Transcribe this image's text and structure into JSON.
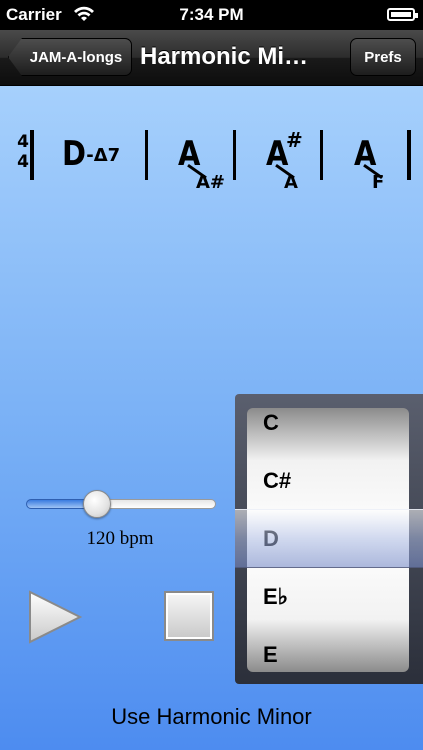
{
  "status_bar": {
    "carrier": "Carrier",
    "time": "7:34 PM"
  },
  "nav": {
    "back_label": "JAM-A-longs",
    "title": "Harmonic Mi…",
    "prefs_label": "Prefs"
  },
  "chart": {
    "time_signature_top": "4",
    "time_signature_bottom": "4",
    "chords": [
      {
        "root": "D",
        "quality": "-Δ7",
        "sharp": "",
        "bass": ""
      },
      {
        "root": "A",
        "quality": "",
        "sharp": "",
        "bass": "A#"
      },
      {
        "root": "A",
        "quality": "",
        "sharp": "#",
        "bass": "A"
      },
      {
        "root": "A",
        "quality": "",
        "sharp": "",
        "bass": "F"
      }
    ]
  },
  "tempo": {
    "bpm_label": "120 bpm",
    "slider_fraction": 0.35
  },
  "picker": {
    "items": [
      "C",
      "C#",
      "D",
      "E♭",
      "E"
    ],
    "selected": "D"
  },
  "footer": {
    "text": "Use Harmonic Minor"
  },
  "colors": {
    "background_top": "#a6d0fc",
    "background_bottom": "#4d8cf0"
  }
}
